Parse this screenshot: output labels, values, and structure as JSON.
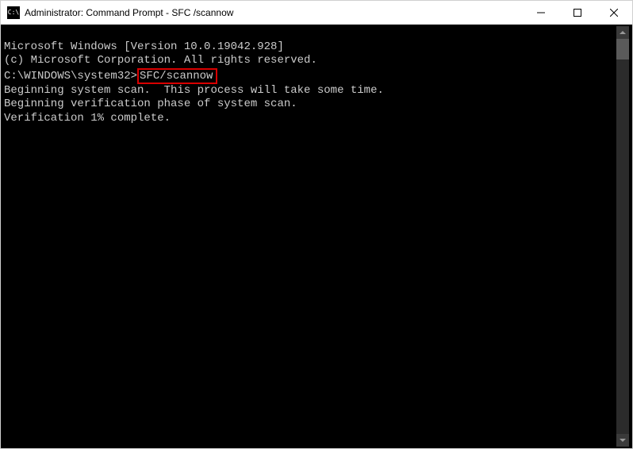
{
  "titlebar": {
    "icon_label": "C:\\",
    "title": "Administrator: Command Prompt - SFC /scannow"
  },
  "terminal": {
    "line1": "Microsoft Windows [Version 10.0.19042.928]",
    "line2": "(c) Microsoft Corporation. All rights reserved.",
    "blank1": "",
    "prompt_prefix": "C:\\WINDOWS\\system32>",
    "command_highlight": "SFC/scannow",
    "blank2": "",
    "line3": "Beginning system scan.  This process will take some time.",
    "blank3": "",
    "line4": "Beginning verification phase of system scan.",
    "line5": "Verification 1% complete."
  }
}
